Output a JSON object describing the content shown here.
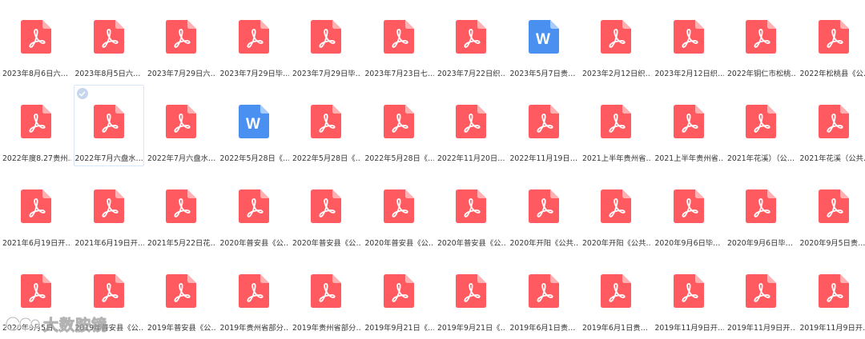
{
  "colors": {
    "pdf": "#ff5a5f",
    "pdf_fold": "#ffb0b2",
    "word": "#4a90f0",
    "word_fold": "#a9cbfa",
    "selection_border": "#d6e6fb",
    "check_bg": "#c6d6ec"
  },
  "files": [
    {
      "name": "2023年8月6日六…",
      "type": "pdf",
      "icon": "pdf-icon"
    },
    {
      "name": "2023年8月5日六…",
      "type": "pdf",
      "icon": "pdf-icon"
    },
    {
      "name": "2023年7月29日六…",
      "type": "pdf",
      "icon": "pdf-icon"
    },
    {
      "name": "2023年7月29日毕…",
      "type": "pdf",
      "icon": "pdf-icon"
    },
    {
      "name": "2023年7月29日毕…",
      "type": "pdf",
      "icon": "pdf-icon"
    },
    {
      "name": "2023年7月23日七…",
      "type": "pdf",
      "icon": "pdf-icon"
    },
    {
      "name": "2023年7月22日织…",
      "type": "pdf",
      "icon": "pdf-icon"
    },
    {
      "name": "2023年5月7日贵…",
      "type": "word",
      "icon": "word-icon",
      "glyph": "W"
    },
    {
      "name": "2023年2月12日织…",
      "type": "pdf",
      "icon": "pdf-icon"
    },
    {
      "name": "2023年2月12日织…",
      "type": "pdf",
      "icon": "pdf-icon"
    },
    {
      "name": "2022年铜仁市松桃…",
      "type": "pdf",
      "icon": "pdf-icon"
    },
    {
      "name": "2022年松桃县《公…",
      "type": "pdf",
      "icon": "pdf-icon"
    },
    {
      "name": "2022年度8.27贵州…",
      "type": "pdf",
      "icon": "pdf-icon"
    },
    {
      "name": "2022年7月六盘水…",
      "type": "pdf",
      "icon": "pdf-icon",
      "selected": true
    },
    {
      "name": "2022年7月六盘水…",
      "type": "pdf",
      "icon": "pdf-icon"
    },
    {
      "name": "2022年5月28日《…",
      "type": "word",
      "icon": "word-icon",
      "glyph": "W"
    },
    {
      "name": "2022年5月28日《…",
      "type": "pdf",
      "icon": "pdf-icon"
    },
    {
      "name": "2022年5月28日《…",
      "type": "pdf",
      "icon": "pdf-icon"
    },
    {
      "name": "2022年11月20日…",
      "type": "pdf",
      "icon": "pdf-icon"
    },
    {
      "name": "2022年11月19日…",
      "type": "pdf",
      "icon": "pdf-icon"
    },
    {
      "name": "2021上半年贵州省…",
      "type": "pdf",
      "icon": "pdf-icon"
    },
    {
      "name": "2021上半年贵州省…",
      "type": "pdf",
      "icon": "pdf-icon"
    },
    {
      "name": "2021年花溪）（公…",
      "type": "pdf",
      "icon": "pdf-icon"
    },
    {
      "name": "2021年花溪（公共…",
      "type": "pdf",
      "icon": "pdf-icon"
    },
    {
      "name": "2021年6月19日开…",
      "type": "pdf",
      "icon": "pdf-icon"
    },
    {
      "name": "2021年6月19日开…",
      "type": "pdf",
      "icon": "pdf-icon"
    },
    {
      "name": "2021年5月22日花…",
      "type": "pdf",
      "icon": "pdf-icon"
    },
    {
      "name": "2020年普安县《公…",
      "type": "pdf",
      "icon": "pdf-icon"
    },
    {
      "name": "2020年普安县《公…",
      "type": "pdf",
      "icon": "pdf-icon"
    },
    {
      "name": "2020年普安县《公…",
      "type": "pdf",
      "icon": "pdf-icon"
    },
    {
      "name": "2020年普安县《公…",
      "type": "pdf",
      "icon": "pdf-icon"
    },
    {
      "name": "2020年开阳《公共…",
      "type": "pdf",
      "icon": "pdf-icon"
    },
    {
      "name": "2020年开阳《公共…",
      "type": "pdf",
      "icon": "pdf-icon"
    },
    {
      "name": "2020年9月6日毕…",
      "type": "pdf",
      "icon": "pdf-icon"
    },
    {
      "name": "2020年9月6日毕…",
      "type": "pdf",
      "icon": "pdf-icon"
    },
    {
      "name": "2020年9月5日贵…",
      "type": "pdf",
      "icon": "pdf-icon"
    },
    {
      "name": "2020年9月5日…",
      "type": "pdf",
      "icon": "pdf-icon"
    },
    {
      "name": "2019年普安县《公…",
      "type": "pdf",
      "icon": "pdf-icon"
    },
    {
      "name": "2019年普安县《公…",
      "type": "pdf",
      "icon": "pdf-icon"
    },
    {
      "name": "2019年贵州省部分…",
      "type": "pdf",
      "icon": "pdf-icon"
    },
    {
      "name": "2019年贵州省部分…",
      "type": "pdf",
      "icon": "pdf-icon"
    },
    {
      "name": "2019年9月21日《…",
      "type": "pdf",
      "icon": "pdf-icon"
    },
    {
      "name": "2019年9月21日《…",
      "type": "pdf",
      "icon": "pdf-icon"
    },
    {
      "name": "2019年6月1日贵…",
      "type": "pdf",
      "icon": "pdf-icon"
    },
    {
      "name": "2019年6月1日贵…",
      "type": "pdf",
      "icon": "pdf-icon"
    },
    {
      "name": "2019年11月9日开…",
      "type": "pdf",
      "icon": "pdf-icon"
    },
    {
      "name": "2019年11月9日开…",
      "type": "pdf",
      "icon": "pdf-icon"
    },
    {
      "name": "2019年11月9日开…",
      "type": "pdf",
      "icon": "pdf-icon"
    }
  ],
  "watermark": {
    "text": "大数胺镜",
    "icon": "watermark-logo-icon"
  }
}
